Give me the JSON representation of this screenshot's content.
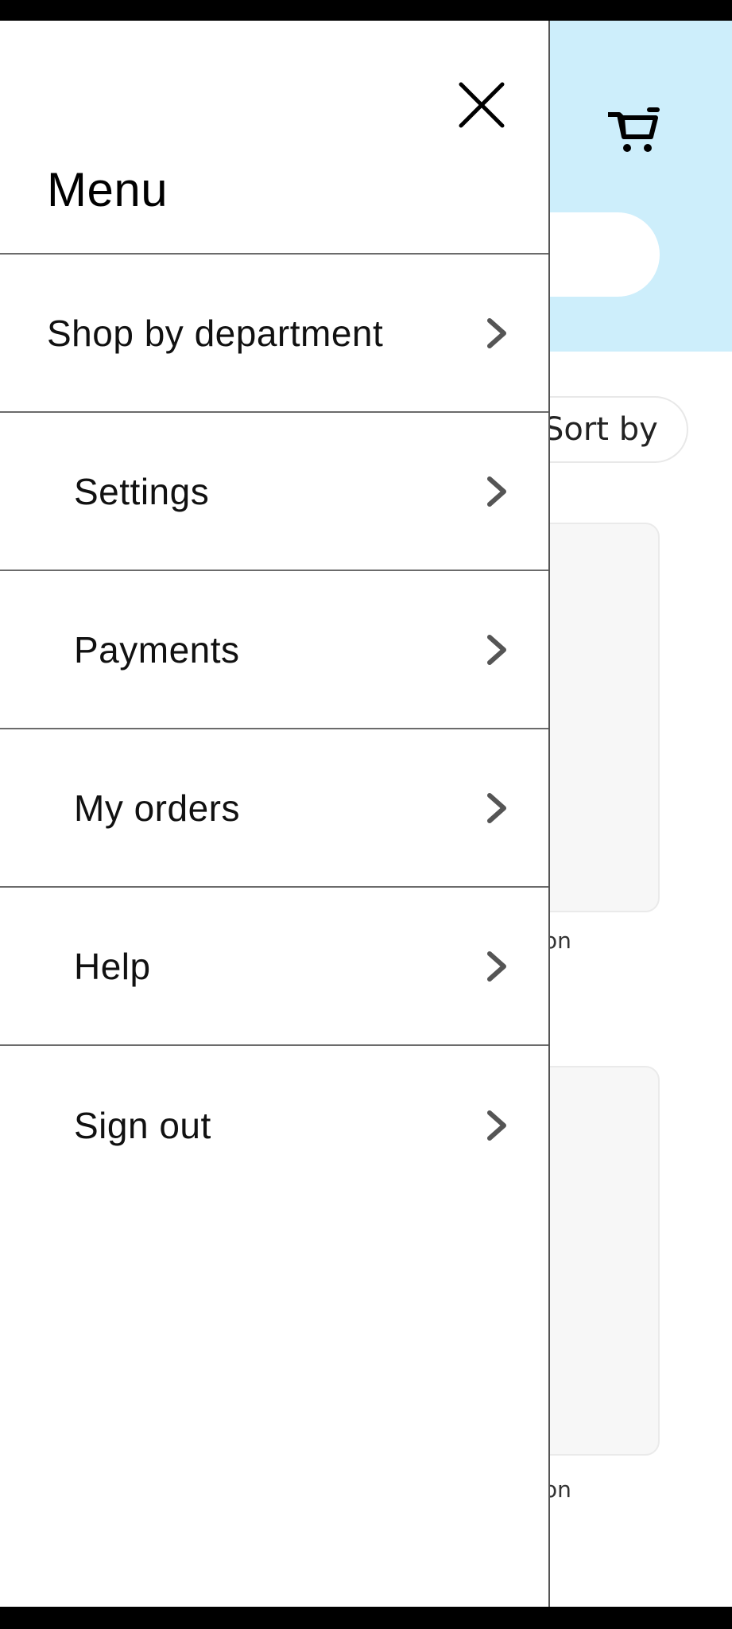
{
  "drawer": {
    "title": "Menu",
    "items": [
      {
        "label": "Shop by department",
        "level": "top"
      },
      {
        "label": "Settings",
        "level": "sub"
      },
      {
        "label": "Payments",
        "level": "sub"
      },
      {
        "label": "My orders",
        "level": "sub"
      },
      {
        "label": "Help",
        "level": "sub"
      },
      {
        "label": "Sign out",
        "level": "sub"
      }
    ]
  },
  "background": {
    "sort_label": "Sort by",
    "product_captions": [
      "on",
      "on"
    ]
  },
  "icons": {
    "close": "close-icon",
    "chevron": "chevron-right-icon",
    "cart": "shopping-cart-icon"
  },
  "colors": {
    "header_bg": "#cdeefb",
    "drawer_bg": "#ffffff",
    "divider": "#6b6b6b",
    "chevron": "#555555"
  }
}
